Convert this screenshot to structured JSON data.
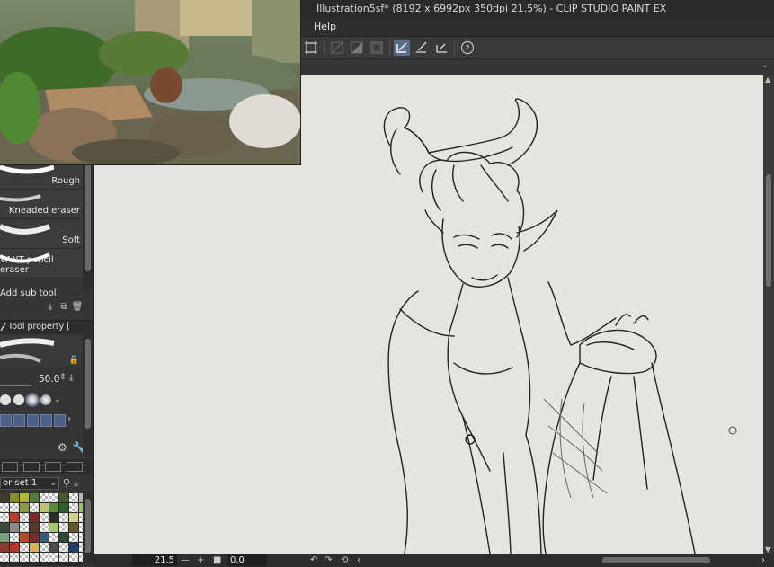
{
  "window": {
    "title": "Illustration5sf* (8192 x 6992px 350dpi 21.5%)  - CLIP STUDIO PAINT EX"
  },
  "menu": {
    "items": [
      "Help"
    ]
  },
  "toolbar": {
    "icons": [
      "transform-icon",
      "snap-off-icon",
      "snap-ruler-icon",
      "snap-grid-icon",
      "stabilizer-pen-icon",
      "stabilizer-brush-icon",
      "stabilizer-eraser-icon",
      "help-question-icon"
    ],
    "active_icon": "stabilizer-pen-icon"
  },
  "subtool_panel": {
    "brushes": [
      {
        "label": "Rough"
      },
      {
        "label": "Kneaded eraser"
      },
      {
        "label": "Soft"
      },
      {
        "label": "VANT pencil eraser"
      }
    ],
    "add_sub_tool": "Add sub tool"
  },
  "tool_property": {
    "header": "Tool property [",
    "brush_size": "50.0",
    "tip_shapes": [
      "hard",
      "hard",
      "selected-soft",
      "soft"
    ]
  },
  "color_set": {
    "selected": "or set 1",
    "palette": [
      "#3f3a2e",
      "#8a8a2c",
      "#b2b83c",
      "#567a3a",
      "checker",
      "checker",
      "#445b2a",
      "checker",
      "#b4b4b4",
      "checker",
      "checker",
      "#8a9a4a",
      "checker",
      "#c2c07a",
      "#5a8a3c",
      "#2f5f2f",
      "checker",
      "#9ec06a",
      "checker",
      "#b93a2e",
      "checker",
      "#7a2828",
      "checker",
      "#2b2b2b",
      "checker",
      "#d4d490",
      "checker",
      "#3a4a3a",
      "#8a8a8a",
      "checker",
      "#5a3a2a",
      "checker",
      "#a3c86c",
      "checker",
      "#64582c",
      "checker",
      "#7aa07a",
      "checker",
      "#b34a2a",
      "#7a2b2b",
      "#3b5a7a",
      "checker",
      "#2e4a3a",
      "checker",
      "checker",
      "#8a3a2a",
      "#b8362b",
      "checker",
      "#d6b05a",
      "checker",
      "#4a4a4a",
      "checker",
      "#1e3f6a",
      "checker",
      "checker",
      "checker",
      "checker",
      "checker",
      "checker",
      "checker",
      "checker",
      "checker",
      "checker"
    ]
  },
  "status": {
    "zoom": "21.5",
    "angle": "0.0"
  },
  "colors": {
    "accent": "#5a6c8c",
    "canvas": "#e6e4df"
  }
}
